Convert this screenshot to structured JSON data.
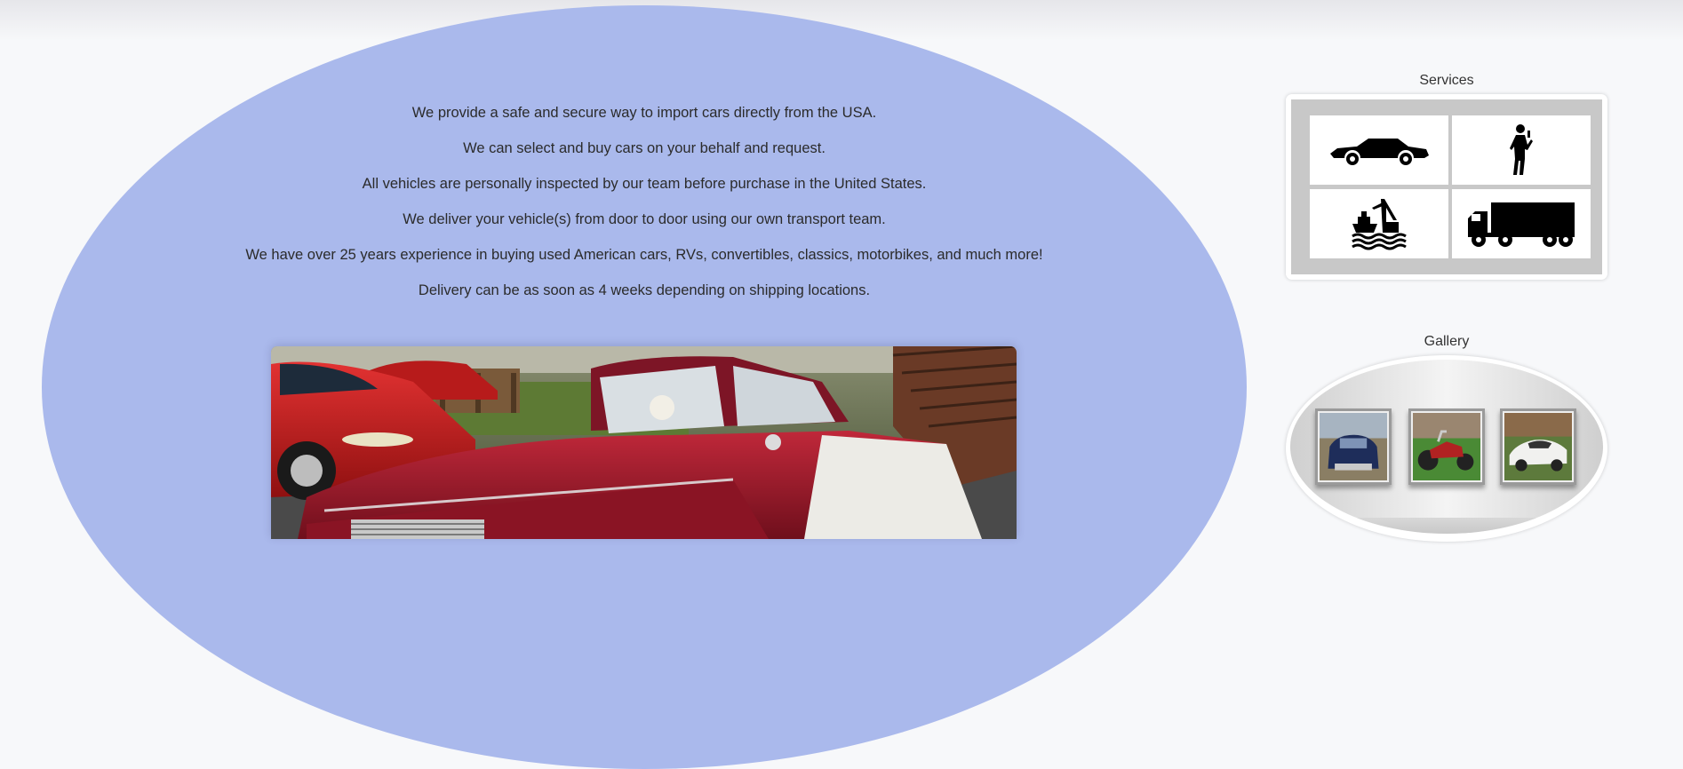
{
  "intro": {
    "lines": [
      "We provide a safe and secure way to import cars directly from the USA.",
      "We can select and buy cars on your behalf and request.",
      "All vehicles are personally inspected by our team before purchase in the United States.",
      "We deliver your vehicle(s) from door to door using our own transport team.",
      "We have over 25 years experience in buying used American cars, RVs, convertibles, classics, motorbikes, and much more!",
      "Delivery can be as soon as 4 weeks depending on shipping locations."
    ]
  },
  "services": {
    "title": "Services",
    "tiles": [
      {
        "icon": "car-icon"
      },
      {
        "icon": "inspector-person-icon"
      },
      {
        "icon": "ship-port-icon"
      },
      {
        "icon": "truck-icon"
      }
    ]
  },
  "gallery": {
    "title": "Gallery",
    "thumbnails": [
      {
        "icon": "blue-sedan-photo"
      },
      {
        "icon": "motor-trike-photo"
      },
      {
        "icon": "white-sports-car-photo"
      }
    ]
  },
  "hero": {
    "image": "red-plymouth-classic-car-photo"
  },
  "colors": {
    "blob": "#aab9ec",
    "page": "#f7f8fa",
    "tile_bg": "#c8c8c8"
  }
}
